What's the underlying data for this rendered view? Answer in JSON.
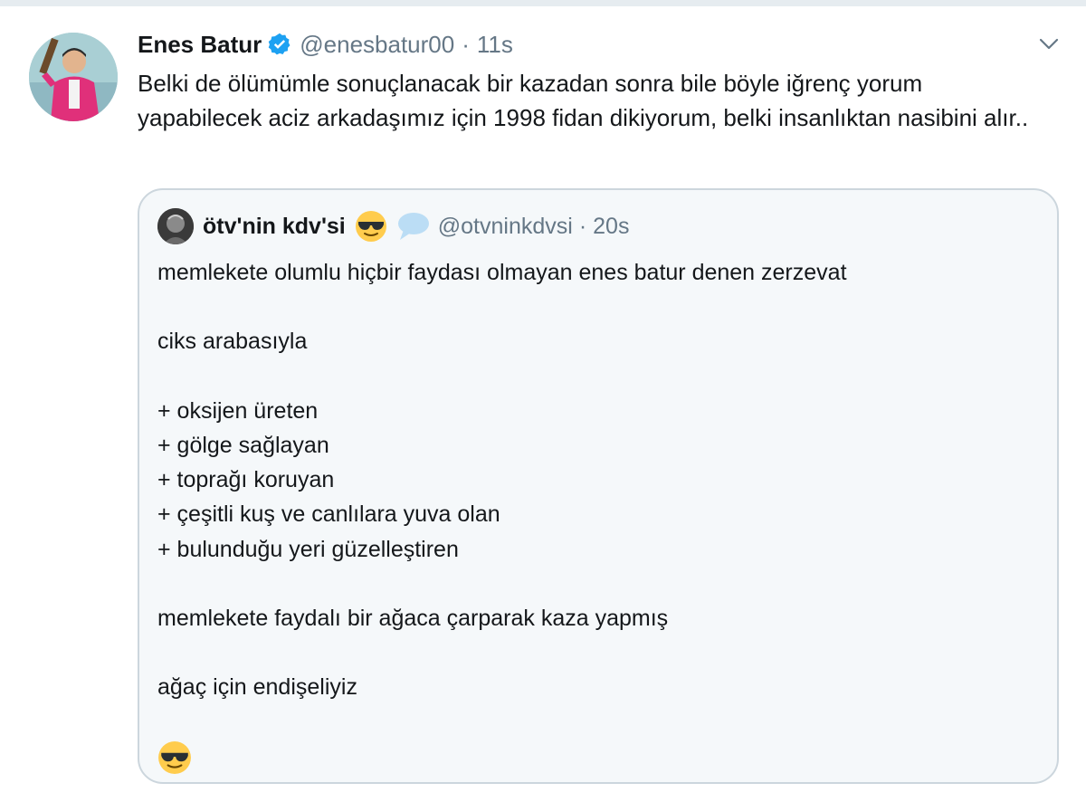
{
  "tweet": {
    "author_name": "Enes Batur",
    "handle": "@enesbatur00",
    "separator": "·",
    "time": "11s",
    "verified_icon": "verified-badge-icon",
    "menu_icon": "chevron-down-icon",
    "text": "Belki de ölümümle sonuçlanacak bir kazadan sonra bile böyle iğrenç yorum yapabilecek aciz arkadaşımız için 1998 fidan dikiyorum, belki insanlıktan nasibini alır..",
    "avatar_icon": "profile-photo"
  },
  "quote": {
    "author_name": "ötv'nin kdv'si",
    "handle": "@otvninkdvsi",
    "separator": "·",
    "time": "20s",
    "name_emojis": [
      "sunglasses-emoji-icon",
      "speech-bubble-emoji-icon"
    ],
    "lines": [
      "memlekete olumlu hiçbir faydası olmayan enes batur denen zerzevat",
      "",
      "ciks arabasıyla",
      "",
      "+ oksijen üreten",
      "+ gölge sağlayan",
      "+ toprağı koruyan",
      "+ çeşitli kuş ve canlılara yuva olan",
      "+ bulunduğu yeri güzelleştiren",
      "",
      "memlekete faydalı bir ağaca çarparak kaza yapmış",
      "",
      "ağaç için endişeliyiz",
      ""
    ],
    "closing_emoji": "sunglasses-emoji-icon"
  },
  "colors": {
    "text": "#14171a",
    "secondary": "#657786",
    "verified": "#1da1f2",
    "quote_bg": "#f5f8fa",
    "quote_border": "#ccd6dd"
  }
}
